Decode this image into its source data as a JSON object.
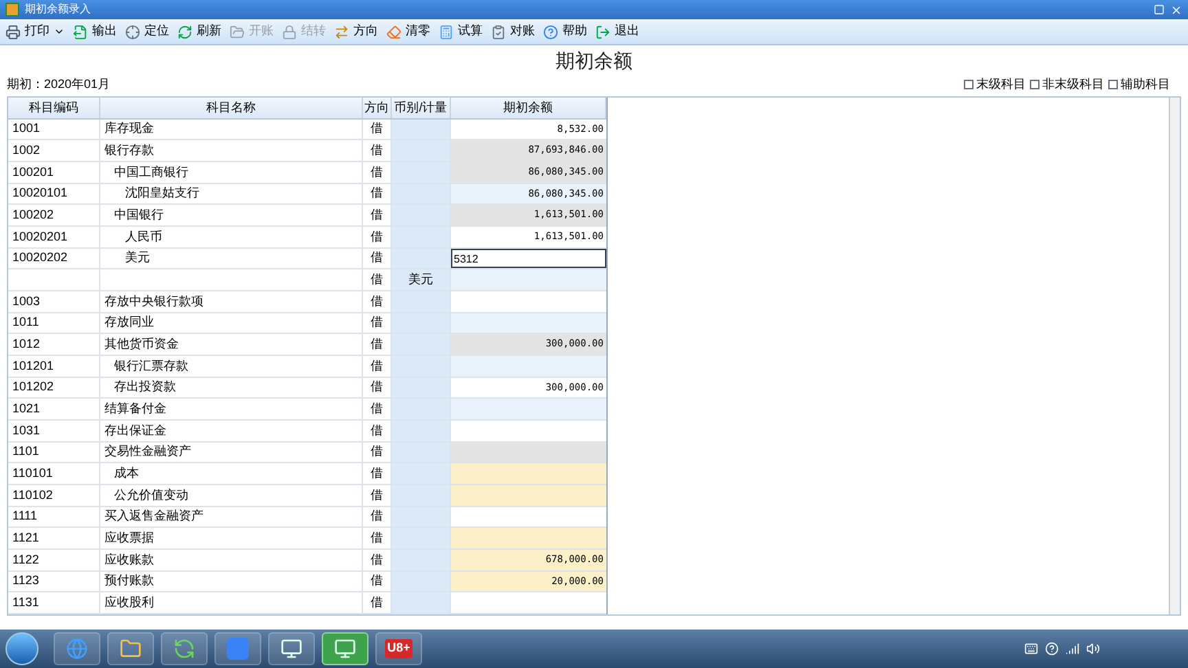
{
  "window": {
    "title": "期初余额录入"
  },
  "toolbar": [
    {
      "label": "打印",
      "kind": "print",
      "disabled": false,
      "dropdown": true
    },
    {
      "label": "输出",
      "kind": "export",
      "disabled": false,
      "dropdown": false
    },
    {
      "label": "定位",
      "kind": "locate",
      "disabled": false,
      "dropdown": false
    },
    {
      "label": "刷新",
      "kind": "refresh",
      "disabled": false,
      "dropdown": false
    },
    {
      "label": "开账",
      "kind": "open",
      "disabled": true,
      "dropdown": false
    },
    {
      "label": "结转",
      "kind": "carry",
      "disabled": true,
      "dropdown": false
    },
    {
      "label": "方向",
      "kind": "direction",
      "disabled": false,
      "dropdown": false
    },
    {
      "label": "清零",
      "kind": "clear",
      "disabled": false,
      "dropdown": false
    },
    {
      "label": "试算",
      "kind": "calc",
      "disabled": false,
      "dropdown": false
    },
    {
      "label": "对账",
      "kind": "reconcile",
      "disabled": false,
      "dropdown": false
    },
    {
      "label": "帮助",
      "kind": "help",
      "disabled": false,
      "dropdown": false
    },
    {
      "label": "退出",
      "kind": "exit",
      "disabled": false,
      "dropdown": false
    }
  ],
  "heading": "期初余额",
  "period": "期初：2020年01月",
  "filters": [
    {
      "label": "末级科目",
      "checked": false
    },
    {
      "label": "非末级科目",
      "checked": false
    },
    {
      "label": "辅助科目",
      "checked": false
    }
  ],
  "table": {
    "columns": [
      "科目编码",
      "科目名称",
      "方向",
      "币别/计量",
      "期初余额"
    ],
    "rows": [
      {
        "code": "1001",
        "name": "库存现金",
        "dir": "借",
        "amount": "8,532.00",
        "kind": "plain"
      },
      {
        "code": "1002",
        "name": "银行存款",
        "dir": "借",
        "amount": "87,693,846.00",
        "kind": "summary",
        "children": [
          {
            "code": "100201",
            "name": "中国工商银行",
            "dir": "借",
            "amount": "86,080,345.00",
            "kind": "summary",
            "children": [
              {
                "code": "10020101",
                "name": "沈阳皇姑支行",
                "dir": "借",
                "amount": "86,080,345.00",
                "kind": "shaded"
              }
            ]
          },
          {
            "code": "100202",
            "name": "中国银行",
            "dir": "借",
            "amount": "1,613,501.00",
            "kind": "summary",
            "children": [
              {
                "code": "10020201",
                "name": "人民币",
                "dir": "借",
                "amount": "1,613,501.00",
                "kind": "plain"
              },
              {
                "code": "10020202",
                "name": "美元",
                "dir": "借",
                "amount": "5312",
                "kind": "editing",
                "children": [
                  {
                    "dir": "借",
                    "currency": "美元",
                    "kind": "shaded"
                  }
                ]
              }
            ]
          }
        ]
      },
      {
        "code": "1003",
        "name": "存放中央银行款项",
        "dir": "借",
        "kind": "plain"
      },
      {
        "code": "1011",
        "name": "存放同业",
        "dir": "借",
        "kind": "shaded"
      },
      {
        "code": "1012",
        "name": "其他货币资金",
        "dir": "借",
        "amount": "300,000.00",
        "kind": "summary",
        "children": [
          {
            "code": "101201",
            "name": "银行汇票存款",
            "dir": "借",
            "kind": "shaded"
          },
          {
            "code": "101202",
            "name": "存出投资款",
            "dir": "借",
            "amount": "300,000.00",
            "kind": "plain"
          }
        ]
      },
      {
        "code": "1021",
        "name": "结算备付金",
        "dir": "借",
        "kind": "shaded"
      },
      {
        "code": "1031",
        "name": "存出保证金",
        "dir": "借",
        "kind": "plain"
      },
      {
        "code": "1101",
        "name": "交易性金融资产",
        "dir": "借",
        "kind": "summary",
        "children": [
          {
            "code": "110101",
            "name": "成本",
            "dir": "借",
            "kind": "auxiliary"
          },
          {
            "code": "110102",
            "name": "公允价值变动",
            "dir": "借",
            "kind": "auxiliary"
          }
        ]
      },
      {
        "code": "1111",
        "name": "买入返售金融资产",
        "dir": "借",
        "kind": "plain"
      },
      {
        "code": "1121",
        "name": "应收票据",
        "dir": "借",
        "kind": "auxiliary"
      },
      {
        "code": "1122",
        "name": "应收账款",
        "dir": "借",
        "amount": "678,000.00",
        "kind": "auxiliary"
      },
      {
        "code": "1123",
        "name": "预付账款",
        "dir": "借",
        "amount": "20,000.00",
        "kind": "auxiliary"
      },
      {
        "code": "1131",
        "name": "应收股利",
        "dir": "借",
        "kind": "plain"
      }
    ]
  },
  "taskbar": {
    "apps": [
      {
        "kind": "ie",
        "active": false
      },
      {
        "kind": "folder",
        "active": false
      },
      {
        "kind": "sync",
        "active": false
      },
      {
        "kind": "wps",
        "active": false
      },
      {
        "kind": "app",
        "active": false
      },
      {
        "kind": "app",
        "active": true
      },
      {
        "kind": "u8",
        "active": false,
        "label": "U8+"
      }
    ]
  }
}
